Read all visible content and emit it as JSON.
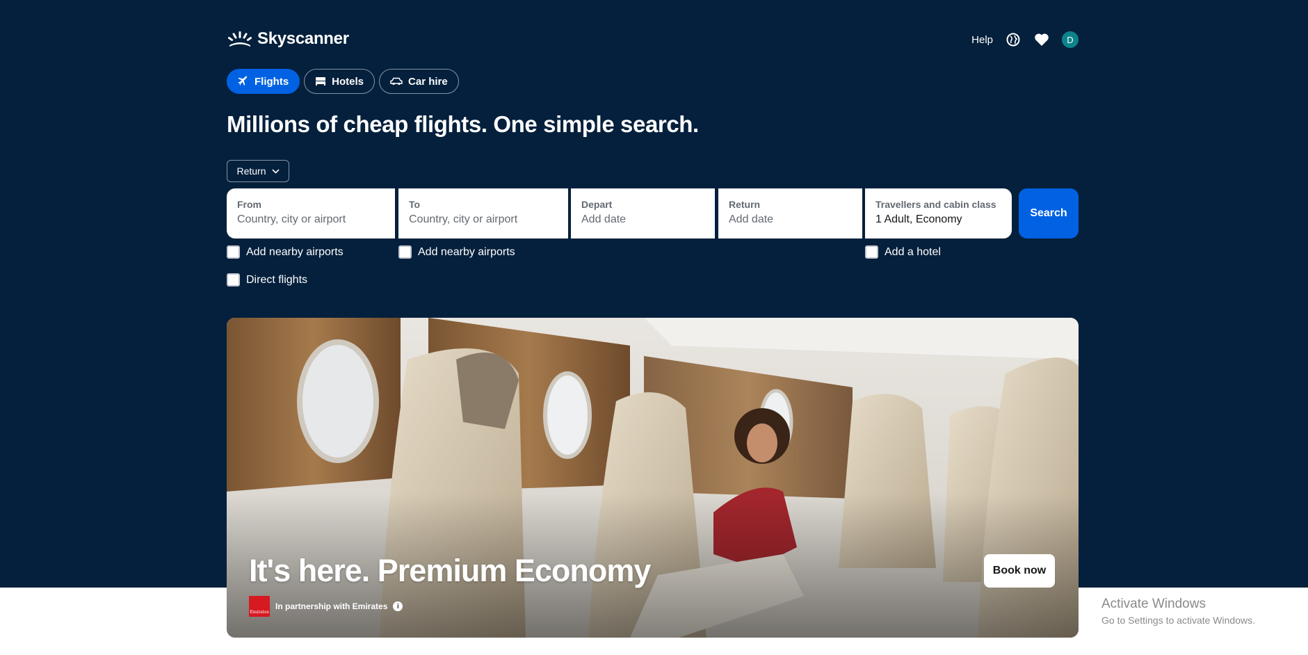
{
  "brand": {
    "name": "Skyscanner"
  },
  "header": {
    "help_label": "Help",
    "avatar_initial": "D"
  },
  "tabs": [
    {
      "label": "Flights",
      "icon": "plane-icon",
      "active": true
    },
    {
      "label": "Hotels",
      "icon": "bed-icon",
      "active": false
    },
    {
      "label": "Car hire",
      "icon": "car-icon",
      "active": false
    }
  ],
  "headline": "Millions of cheap flights. One simple search.",
  "trip_type": {
    "selected": "Return"
  },
  "search": {
    "from": {
      "label": "From",
      "placeholder": "Country, city or airport"
    },
    "to": {
      "label": "To",
      "placeholder": "Country, city or airport"
    },
    "depart": {
      "label": "Depart",
      "placeholder": "Add date"
    },
    "return": {
      "label": "Return",
      "placeholder": "Add date"
    },
    "travellers": {
      "label": "Travellers and cabin class",
      "value": "1 Adult, Economy"
    },
    "button_label": "Search"
  },
  "options": {
    "nearby_from": "Add nearby airports",
    "nearby_to": "Add nearby airports",
    "add_hotel": "Add a hotel",
    "direct_flights": "Direct flights"
  },
  "banner": {
    "headline": "It's here. Premium Economy",
    "partner_text": "In partnership with Emirates",
    "partner_logo_text": "Emirates",
    "cta_label": "Book now"
  },
  "watermark": {
    "title": "Activate Windows",
    "subtitle": "Go to Settings to activate Windows."
  },
  "colors": {
    "hero_bg": "#05203c",
    "primary": "#0062e3",
    "avatar": "#0c838a",
    "emirates_red": "#d71921"
  }
}
